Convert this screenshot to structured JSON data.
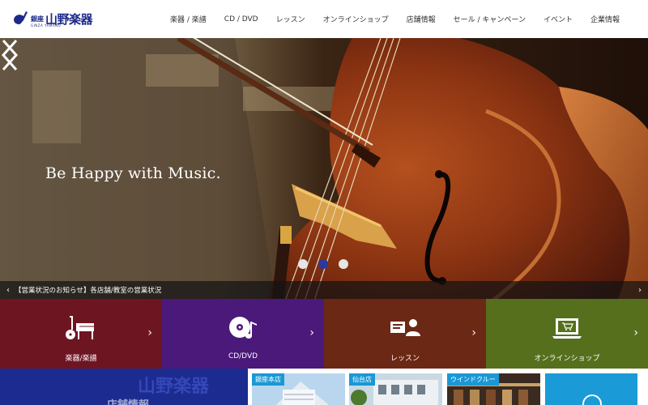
{
  "header": {
    "logo": {
      "ginza": "銀座",
      "main": "山野楽器",
      "sub": "GINZA YAMANO"
    },
    "nav": [
      "楽器 / 楽譜",
      "CD / DVD",
      "レッスン",
      "オンラインショップ",
      "店舗情報",
      "セール / キャンペーン",
      "イベント",
      "企業情報"
    ]
  },
  "hero": {
    "tagline": "Be Happy with Music.",
    "prev_icon": "chevron-left-icon",
    "next_icon": "chevron-right-icon",
    "slides": 3,
    "active_slide": 2
  },
  "news": {
    "text": "【営業状況のお知らせ】各店舗/教室の営業状況"
  },
  "tiles": [
    {
      "label": "楽器/楽譜",
      "icon": "piano-guitar-icon",
      "color": "#6e1522"
    },
    {
      "label": "CD/DVD",
      "icon": "cd-music-icon",
      "color": "#4a1979"
    },
    {
      "label": "レッスン",
      "icon": "lesson-board-icon",
      "color": "#6b2815"
    },
    {
      "label": "オンラインショップ",
      "icon": "laptop-cart-icon",
      "color": "#566f1c"
    }
  ],
  "stores": {
    "banner_text": "店舗情報",
    "thumbs": [
      "銀座本店",
      "仙台店",
      "ウインドクルー"
    ]
  }
}
